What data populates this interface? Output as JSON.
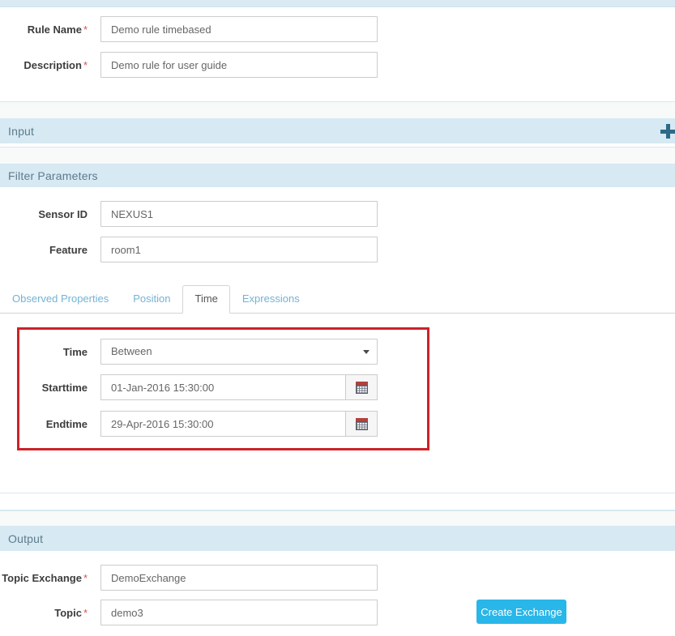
{
  "theme": {
    "band_blue": "#d7e9f2",
    "band_gray": "#f8f9f9",
    "accent_button": "#29b6e8",
    "highlight_border": "#cc2229",
    "required_marker": "#d9534f",
    "tab_link": "#74b3d4"
  },
  "rule": {
    "name_label": "Rule Name",
    "name_value": "Demo rule timebased",
    "name_placeholder": "Rule Name",
    "description_label": "Description",
    "description_value": "Demo rule for user guide",
    "description_placeholder": "Description",
    "required_marker": "*"
  },
  "input_section": {
    "title": "Input",
    "add_icon": "plus-icon"
  },
  "filter_parameters": {
    "title": "Filter Parameters",
    "sensor_id_label": "Sensor ID",
    "sensor_id_value": "NEXUS1",
    "sensor_id_placeholder": "Sensor ID",
    "feature_label": "Feature",
    "feature_value": "room1",
    "feature_placeholder": "Feature"
  },
  "tabs": [
    {
      "label": "Observed Properties",
      "active": false
    },
    {
      "label": "Position",
      "active": false
    },
    {
      "label": "Time",
      "active": true
    },
    {
      "label": "Expressions",
      "active": false
    }
  ],
  "time_panel": {
    "time_label": "Time",
    "time_selected": "Between",
    "time_options": [
      "Between"
    ],
    "starttime_label": "Starttime",
    "starttime_value": "01-Jan-2016 15:30:00",
    "starttime_placeholder": "Starttime",
    "endtime_label": "Endtime",
    "endtime_value": "29-Apr-2016 15:30:00",
    "endtime_placeholder": "Endtime",
    "calendar_icon": "calendar-icon"
  },
  "output_section": {
    "title": "Output",
    "topic_exchange_label": "Topic Exchange",
    "topic_exchange_value": "DemoExchange",
    "topic_exchange_placeholder": "Topic Exchange",
    "topic_label": "Topic",
    "topic_value": "demo3",
    "topic_placeholder": "Topic",
    "required_marker": "*",
    "create_exchange_label": "Create Exchange"
  }
}
